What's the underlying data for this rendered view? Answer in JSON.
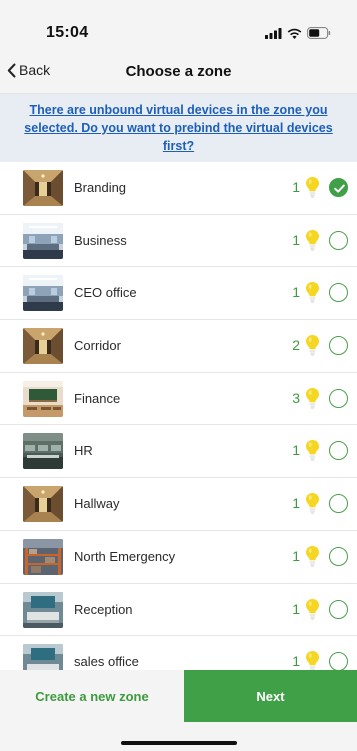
{
  "status_bar": {
    "time": "15:04"
  },
  "nav": {
    "back_label": "Back",
    "title": "Choose a zone"
  },
  "notice": {
    "text": "There are unbound virtual devices in the zone you selected. Do you want to prebind the virtual devices first?"
  },
  "zones": [
    {
      "name": "Branding",
      "count": "1",
      "selected": true
    },
    {
      "name": "Business",
      "count": "1",
      "selected": false
    },
    {
      "name": "CEO office",
      "count": "1",
      "selected": false
    },
    {
      "name": "Corridor",
      "count": "2",
      "selected": false
    },
    {
      "name": "Finance",
      "count": "3",
      "selected": false
    },
    {
      "name": "HR",
      "count": "1",
      "selected": false
    },
    {
      "name": "Hallway",
      "count": "1",
      "selected": false
    },
    {
      "name": "North Emergency",
      "count": "1",
      "selected": false
    },
    {
      "name": "Reception",
      "count": "1",
      "selected": false
    },
    {
      "name": "sales office",
      "count": "1",
      "selected": false
    }
  ],
  "footer": {
    "create_label": "Create a new zone",
    "next_label": "Next"
  },
  "colors": {
    "accent": "#3fa047",
    "link": "#1d5fb8",
    "bulb": "#f5d623"
  }
}
